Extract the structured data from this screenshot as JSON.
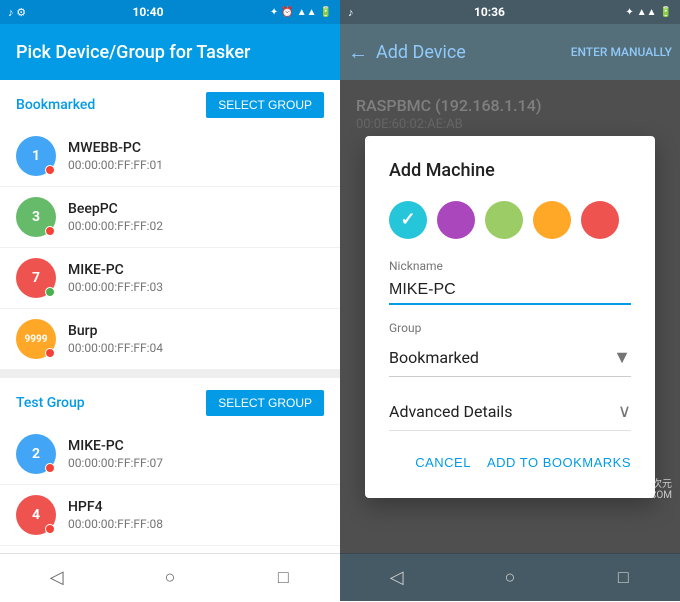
{
  "left": {
    "status_bar": {
      "time": "10:40"
    },
    "header": {
      "title": "Pick Device/Group for Tasker"
    },
    "sections": [
      {
        "id": "bookmarked",
        "title": "Bookmarked",
        "select_btn": "SELECT GROUP",
        "devices": [
          {
            "id": "1",
            "color": "#42A5F5",
            "name": "MWEBB-PC",
            "mac": "00:00:00:FF:FF:01",
            "badge": "red"
          },
          {
            "id": "3",
            "color": "#66BB6A",
            "name": "BeepPC",
            "mac": "00:00:00:FF:FF:02",
            "badge": "red"
          },
          {
            "id": "7",
            "color": "#EF5350",
            "name": "MIKE-PC",
            "mac": "00:00:00:FF:FF:03",
            "badge": "green"
          },
          {
            "id": "9999",
            "color": "#FFA726",
            "name": "Burp",
            "mac": "00:00:00:FF:FF:04",
            "badge": "red"
          }
        ]
      },
      {
        "id": "test-group",
        "title": "Test Group",
        "select_btn": "SELECT GROUP",
        "devices": [
          {
            "id": "2",
            "color": "#42A5F5",
            "name": "MIKE-PC",
            "mac": "00:00:00:FF:FF:07",
            "badge": "red"
          },
          {
            "id": "4",
            "color": "#EF5350",
            "name": "HPF4",
            "mac": "00:00:00:FF:FF:08",
            "badge": "red"
          }
        ]
      }
    ],
    "nav": {
      "back": "◁",
      "home": "○",
      "recent": "□"
    }
  },
  "right": {
    "status_bar": {
      "time": "10:36"
    },
    "header": {
      "back_icon": "←",
      "title": "Add Device",
      "enter_manually": "ENTER MANUALLY"
    },
    "bg_device": {
      "name": "RASPBMC (192.168.1.14)",
      "mac": "00:0E:60:02:AE:AB"
    },
    "dialog": {
      "title": "Add Machine",
      "colors": [
        {
          "hex": "#26C6DA",
          "selected": true
        },
        {
          "hex": "#AB47BC",
          "selected": false
        },
        {
          "hex": "#9CCC65",
          "selected": false
        },
        {
          "hex": "#FFA726",
          "selected": false
        },
        {
          "hex": "#EF5350",
          "selected": false
        }
      ],
      "nickname_label": "Nickname",
      "nickname_value": "MIKE-PC",
      "group_label": "Group",
      "group_value": "Bookmarked",
      "advanced_label": "Advanced Details",
      "cancel_btn": "CANCEL",
      "add_btn": "ADD TO BOOKMARKS"
    },
    "watermark": {
      "line1": "异次元",
      "line2": "IPLAYSOFT.COM"
    },
    "nav": {
      "back": "◁",
      "home": "○",
      "recent": "□"
    }
  }
}
